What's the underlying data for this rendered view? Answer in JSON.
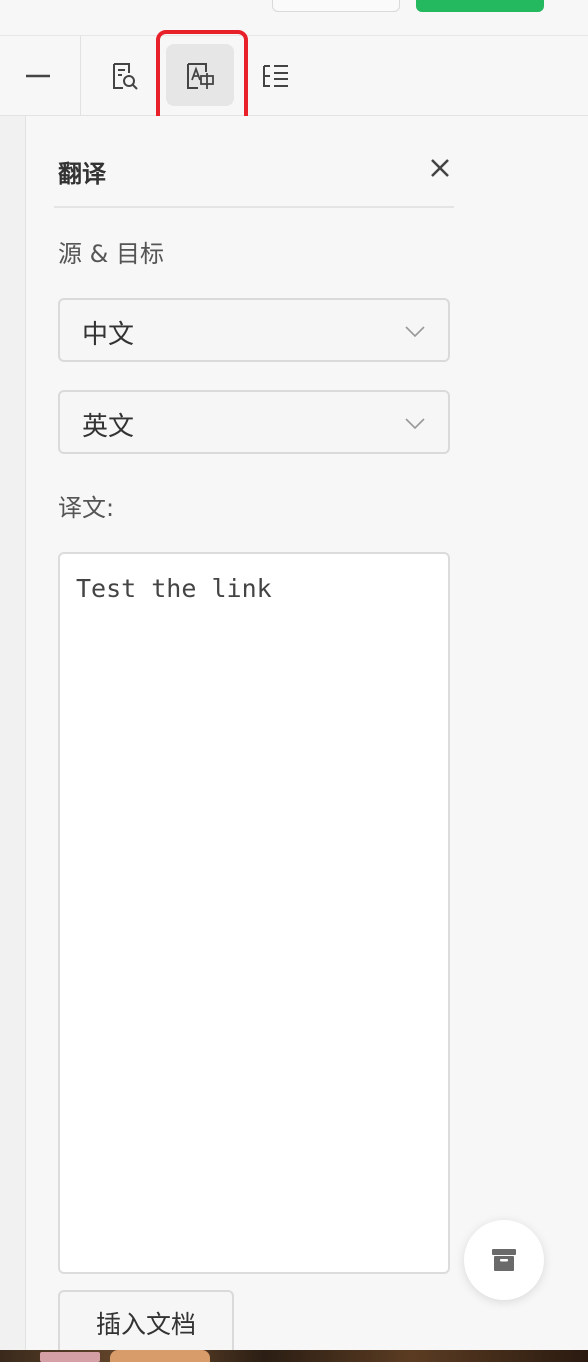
{
  "toolbar": {
    "items": [
      {
        "icon": "minus-icon"
      },
      {
        "icon": "document-search-icon"
      },
      {
        "icon": "translate-icon",
        "active": true
      },
      {
        "icon": "outline-list-icon"
      }
    ]
  },
  "panel": {
    "title": "翻译",
    "close_icon": "close-icon",
    "source_target_label": "源 & 目标",
    "source_language": "中文",
    "target_language": "英文",
    "translation_label": "译文:",
    "translation_text": "Test the link",
    "insert_button": "插入文档"
  },
  "fab": {
    "icon": "archive-icon"
  },
  "colors": {
    "accent_green": "#24b85f",
    "highlight_red": "#e8202a",
    "background": "#f7f7f7"
  }
}
